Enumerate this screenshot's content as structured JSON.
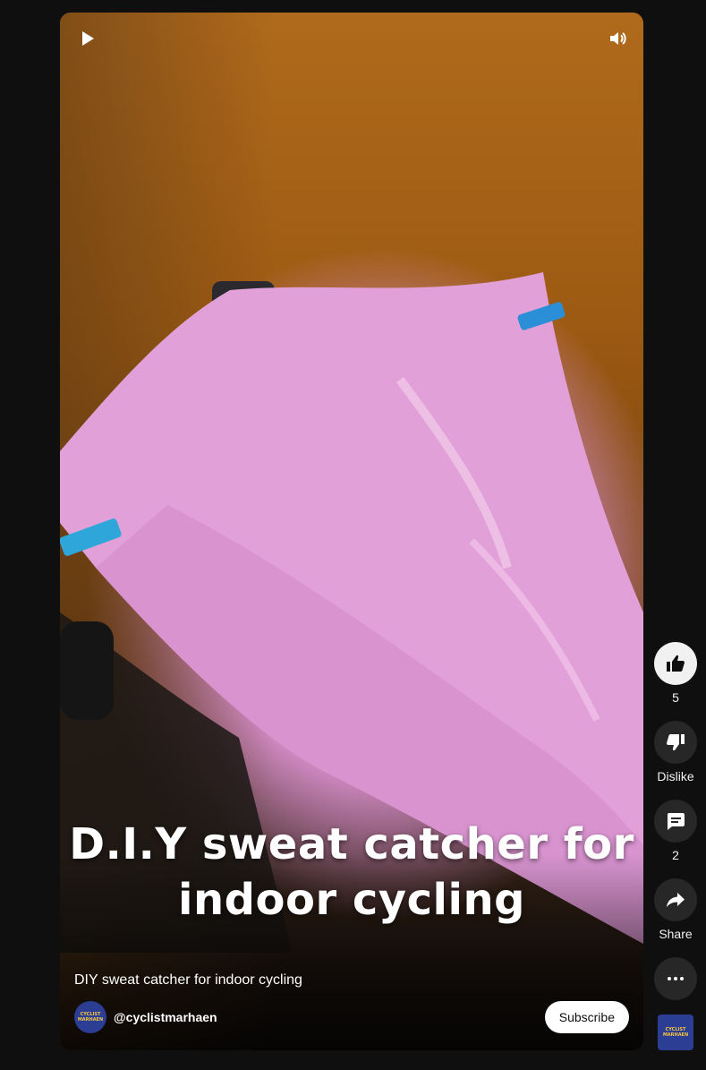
{
  "video": {
    "overlay_line1": "D.I.Y sweat catcher for",
    "overlay_line2": "indoor cycling",
    "title": "DIY sweat catcher for indoor cycling"
  },
  "channel": {
    "handle": "@cyclistmarhaen",
    "logo_line1": "CYCLIST",
    "logo_line2": "MARHAEN",
    "subscribe_label": "Subscribe"
  },
  "controls": {
    "play_icon": "play-icon",
    "volume_icon": "volume-icon"
  },
  "actions": {
    "like_count": "5",
    "dislike_label": "Dislike",
    "comment_count": "2",
    "share_label": "Share"
  },
  "colors": {
    "background": "#0f0f0f",
    "action_circle": "#272727",
    "like_active": "#f1f1f1",
    "avatar_bg": "#2c3e93",
    "towel_pink": "#e2a0d8"
  }
}
